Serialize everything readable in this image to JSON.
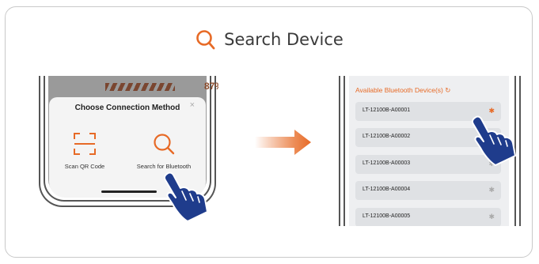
{
  "title": "Search Device",
  "left_phone": {
    "progress_percent": 87,
    "progress_label": "87%",
    "sheet_title": "Choose Connection Method",
    "close_label": "×",
    "options": [
      {
        "label": "Scan QR Code",
        "icon": "scan-qr-icon"
      },
      {
        "label": "Search for Bluetooth",
        "icon": "search-icon"
      }
    ]
  },
  "right_phone": {
    "header": "Available Bluetooth Device(s)",
    "devices": [
      {
        "name": "LT-12100B-A00001"
      },
      {
        "name": "LT-12100B-A00002"
      },
      {
        "name": "LT-12100B-A00003"
      },
      {
        "name": "LT-12100B-A00004"
      },
      {
        "name": "LT-12100B-A00005"
      }
    ]
  },
  "colors": {
    "accent": "#e76a26",
    "hand": "#1f3c8c",
    "text": "#3a3a3a"
  }
}
